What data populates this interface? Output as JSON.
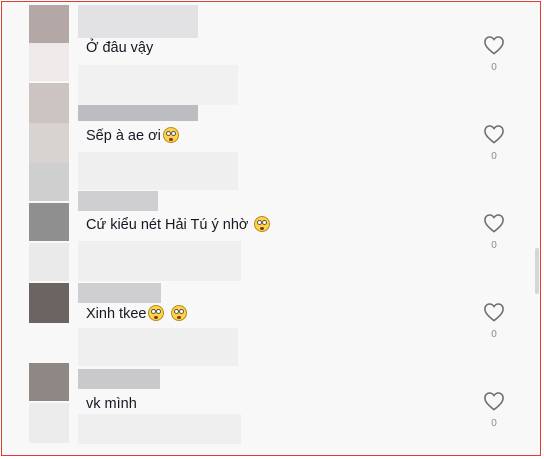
{
  "comments": [
    {
      "text": "Ở đâu vậy",
      "emoji_count": 0,
      "likes": "0",
      "icon": "heart-outline-icon"
    },
    {
      "text": "Sếp à ae ơi",
      "emoji_count": 1,
      "likes": "0",
      "icon": "heart-outline-icon"
    },
    {
      "text": "Cứ kiểu nét Hải Tú ý nhờ",
      "emoji_count": 1,
      "likes": "0",
      "icon": "heart-outline-icon"
    },
    {
      "text": "Xinh tkee",
      "emoji_count": 2,
      "likes": "0",
      "icon": "heart-outline-icon"
    },
    {
      "text": "vk mình",
      "emoji_count": 0,
      "likes": "0",
      "icon": "heart-outline-icon"
    }
  ],
  "colors": {
    "frame_border": "#e53935",
    "text": "#161823",
    "muted": "#8a8b91"
  }
}
